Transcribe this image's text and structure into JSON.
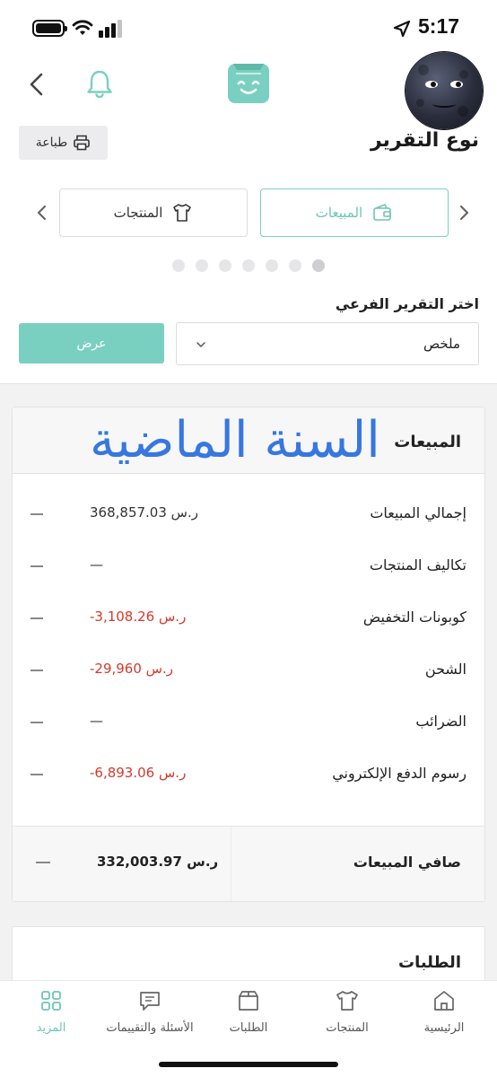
{
  "status_bar": {
    "time": "5:17",
    "battery_icon": "battery-icon",
    "wifi_icon": "wifi-icon",
    "signal_icon": "signal-icon",
    "location_icon": "location-arrow-icon"
  },
  "header": {
    "back_icon": "chevron-left-icon",
    "bell_icon": "bell-icon",
    "logo_icon": "shopping-bag-smile-logo",
    "avatar_icon": "new-moon-face-emoji"
  },
  "report": {
    "title": "نوع التقرير",
    "print_label": "طباعة",
    "types": [
      {
        "label": "المبيعات",
        "icon": "wallet-icon",
        "selected": true
      },
      {
        "label": "المنتجات",
        "icon": "shirt-icon",
        "selected": false
      }
    ],
    "page_dots": 7,
    "active_dot": 1,
    "sub_report_label": "اختر التقرير الفرعي",
    "sub_report_value": "ملخص",
    "view_label": "عرض"
  },
  "sales": {
    "title": "المبيعات",
    "overlay_text": "السنة الماضية",
    "rows": [
      {
        "label": "إجمالي المبيعات",
        "value": "368,857.03 ر.س",
        "negative": false
      },
      {
        "label": "تكاليف المنتجات",
        "value": "—",
        "negative": false
      },
      {
        "label": "كوبونات التخفيض",
        "value": "-3,108.26 ر.س",
        "negative": true
      },
      {
        "label": "الشحن",
        "value": "-29,960 ر.س",
        "negative": true
      },
      {
        "label": "الضرائب",
        "value": "—",
        "negative": false
      },
      {
        "label": "رسوم الدفع الإلكتروني",
        "value": "-6,893.06 ر.س",
        "negative": true
      }
    ],
    "net_label": "صافي المبيعات",
    "net_value": "332,003.97 ر.س"
  },
  "orders": {
    "title": "الطلبات"
  },
  "tabs": [
    {
      "label": "الرئيسية",
      "icon": "home-icon",
      "active": false
    },
    {
      "label": "المنتجات",
      "icon": "shirt-icon",
      "active": false
    },
    {
      "label": "الطلبات",
      "icon": "box-icon",
      "active": false
    },
    {
      "label": "الأسئلة والتقييمات",
      "icon": "chat-icon",
      "active": false
    },
    {
      "label": "المزيد",
      "icon": "grid-icon",
      "active": true
    }
  ],
  "colors": {
    "accent": "#7ad0c0",
    "accent_text": "#6fc5b4",
    "negative": "#d33a2c",
    "overlay": "#3777e0"
  }
}
